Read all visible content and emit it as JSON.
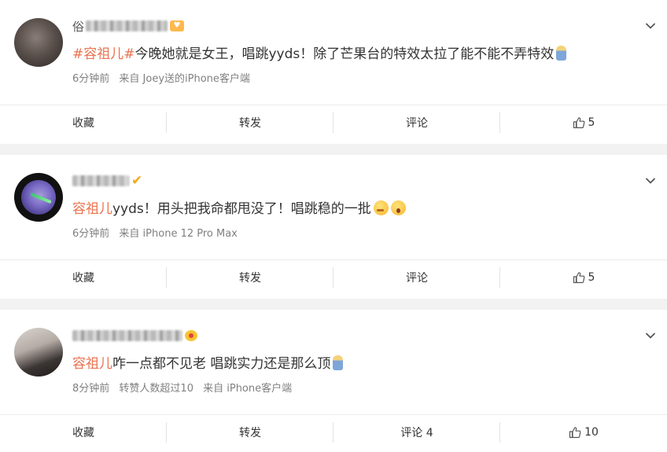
{
  "posts": [
    {
      "name_visible_char": "俗",
      "content_parts": {
        "topic": "#容祖儿#",
        "text": "今晚她就是女王，唱跳yyds！除了芒果台的特效太拉了能不能不弄特效"
      },
      "emojis": [
        "figure-emoji"
      ],
      "meta": {
        "time": "6分钟前",
        "source": "来自 Joey送的iPhone客户端"
      },
      "actions": {
        "favorite": "收藏",
        "repost": "转发",
        "comment": "评论",
        "like_count": "5"
      }
    },
    {
      "content_parts": {
        "topic": "容祖儿",
        "text": "yyds！用头把我命都甩没了！唱跳稳的一批"
      },
      "emojis": [
        "thinking-emoji",
        "wow-emoji"
      ],
      "meta": {
        "time": "6分钟前",
        "source": "来自 iPhone 12 Pro Max"
      },
      "actions": {
        "favorite": "收藏",
        "repost": "转发",
        "comment": "评论",
        "like_count": "5"
      }
    },
    {
      "content_parts": {
        "topic": "容祖儿",
        "text": "咋一点都不见老 唱跳实力还是那么顶"
      },
      "emojis": [
        "figure-emoji"
      ],
      "meta": {
        "time": "8分钟前",
        "extra": "转赞人数超过10",
        "source": "来自 iPhone客户端"
      },
      "actions": {
        "favorite": "收藏",
        "repost": "转发",
        "comment": "评论 4",
        "like_count": "10"
      }
    }
  ],
  "colors": {
    "topic": "#eb7350",
    "meta": "#808080",
    "background": "#f2f2f2"
  }
}
